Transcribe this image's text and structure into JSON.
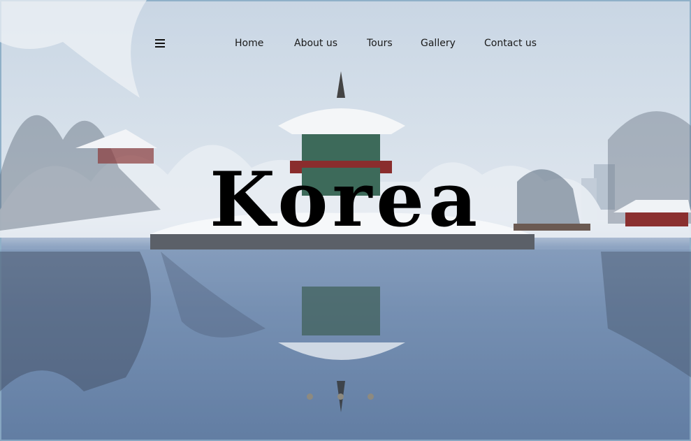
{
  "nav": {
    "links": [
      {
        "label": "Home"
      },
      {
        "label": "About us"
      },
      {
        "label": "Tours"
      },
      {
        "label": "Gallery"
      },
      {
        "label": "Contact us"
      }
    ]
  },
  "hero": {
    "title": "Korea",
    "slides_count": 3,
    "active_slide": 2
  },
  "colors": {
    "sky": "#d6e0ea",
    "water": "#6c86ab",
    "pavilion_red": "#8a2d2d",
    "pavilion_green": "#3d6a5a",
    "dot": "#8d8a80"
  }
}
